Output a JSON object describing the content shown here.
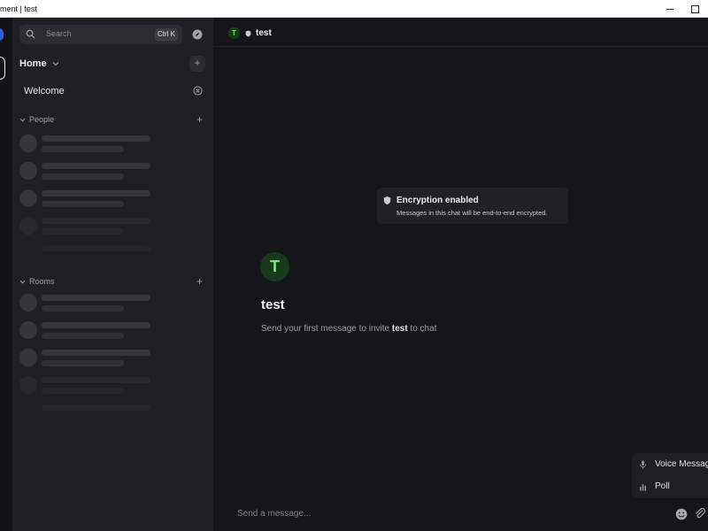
{
  "window": {
    "title": "ment | test"
  },
  "sidebar": {
    "search_placeholder": "Search",
    "search_shortcut": "Ctrl K",
    "home_label": "Home",
    "welcome_label": "Welcome",
    "people_label": "People",
    "rooms_label": "Rooms"
  },
  "room": {
    "name": "test",
    "avatar_letter": "T",
    "encryption_title": "Encryption enabled",
    "encryption_desc": "Messages in this chat will be end-to-end encrypted.",
    "invite_prefix": "Send your first message to invite ",
    "invite_name": "test",
    "invite_suffix": " to chat"
  },
  "composer": {
    "placeholder": "Send a message...",
    "menu": [
      {
        "label": "Voice Message",
        "icon": "microphone-icon"
      },
      {
        "label": "Poll",
        "icon": "poll-icon"
      }
    ]
  },
  "colors": {
    "accent_green": "#5ee86a",
    "space_blue": "#3b5bd6"
  }
}
